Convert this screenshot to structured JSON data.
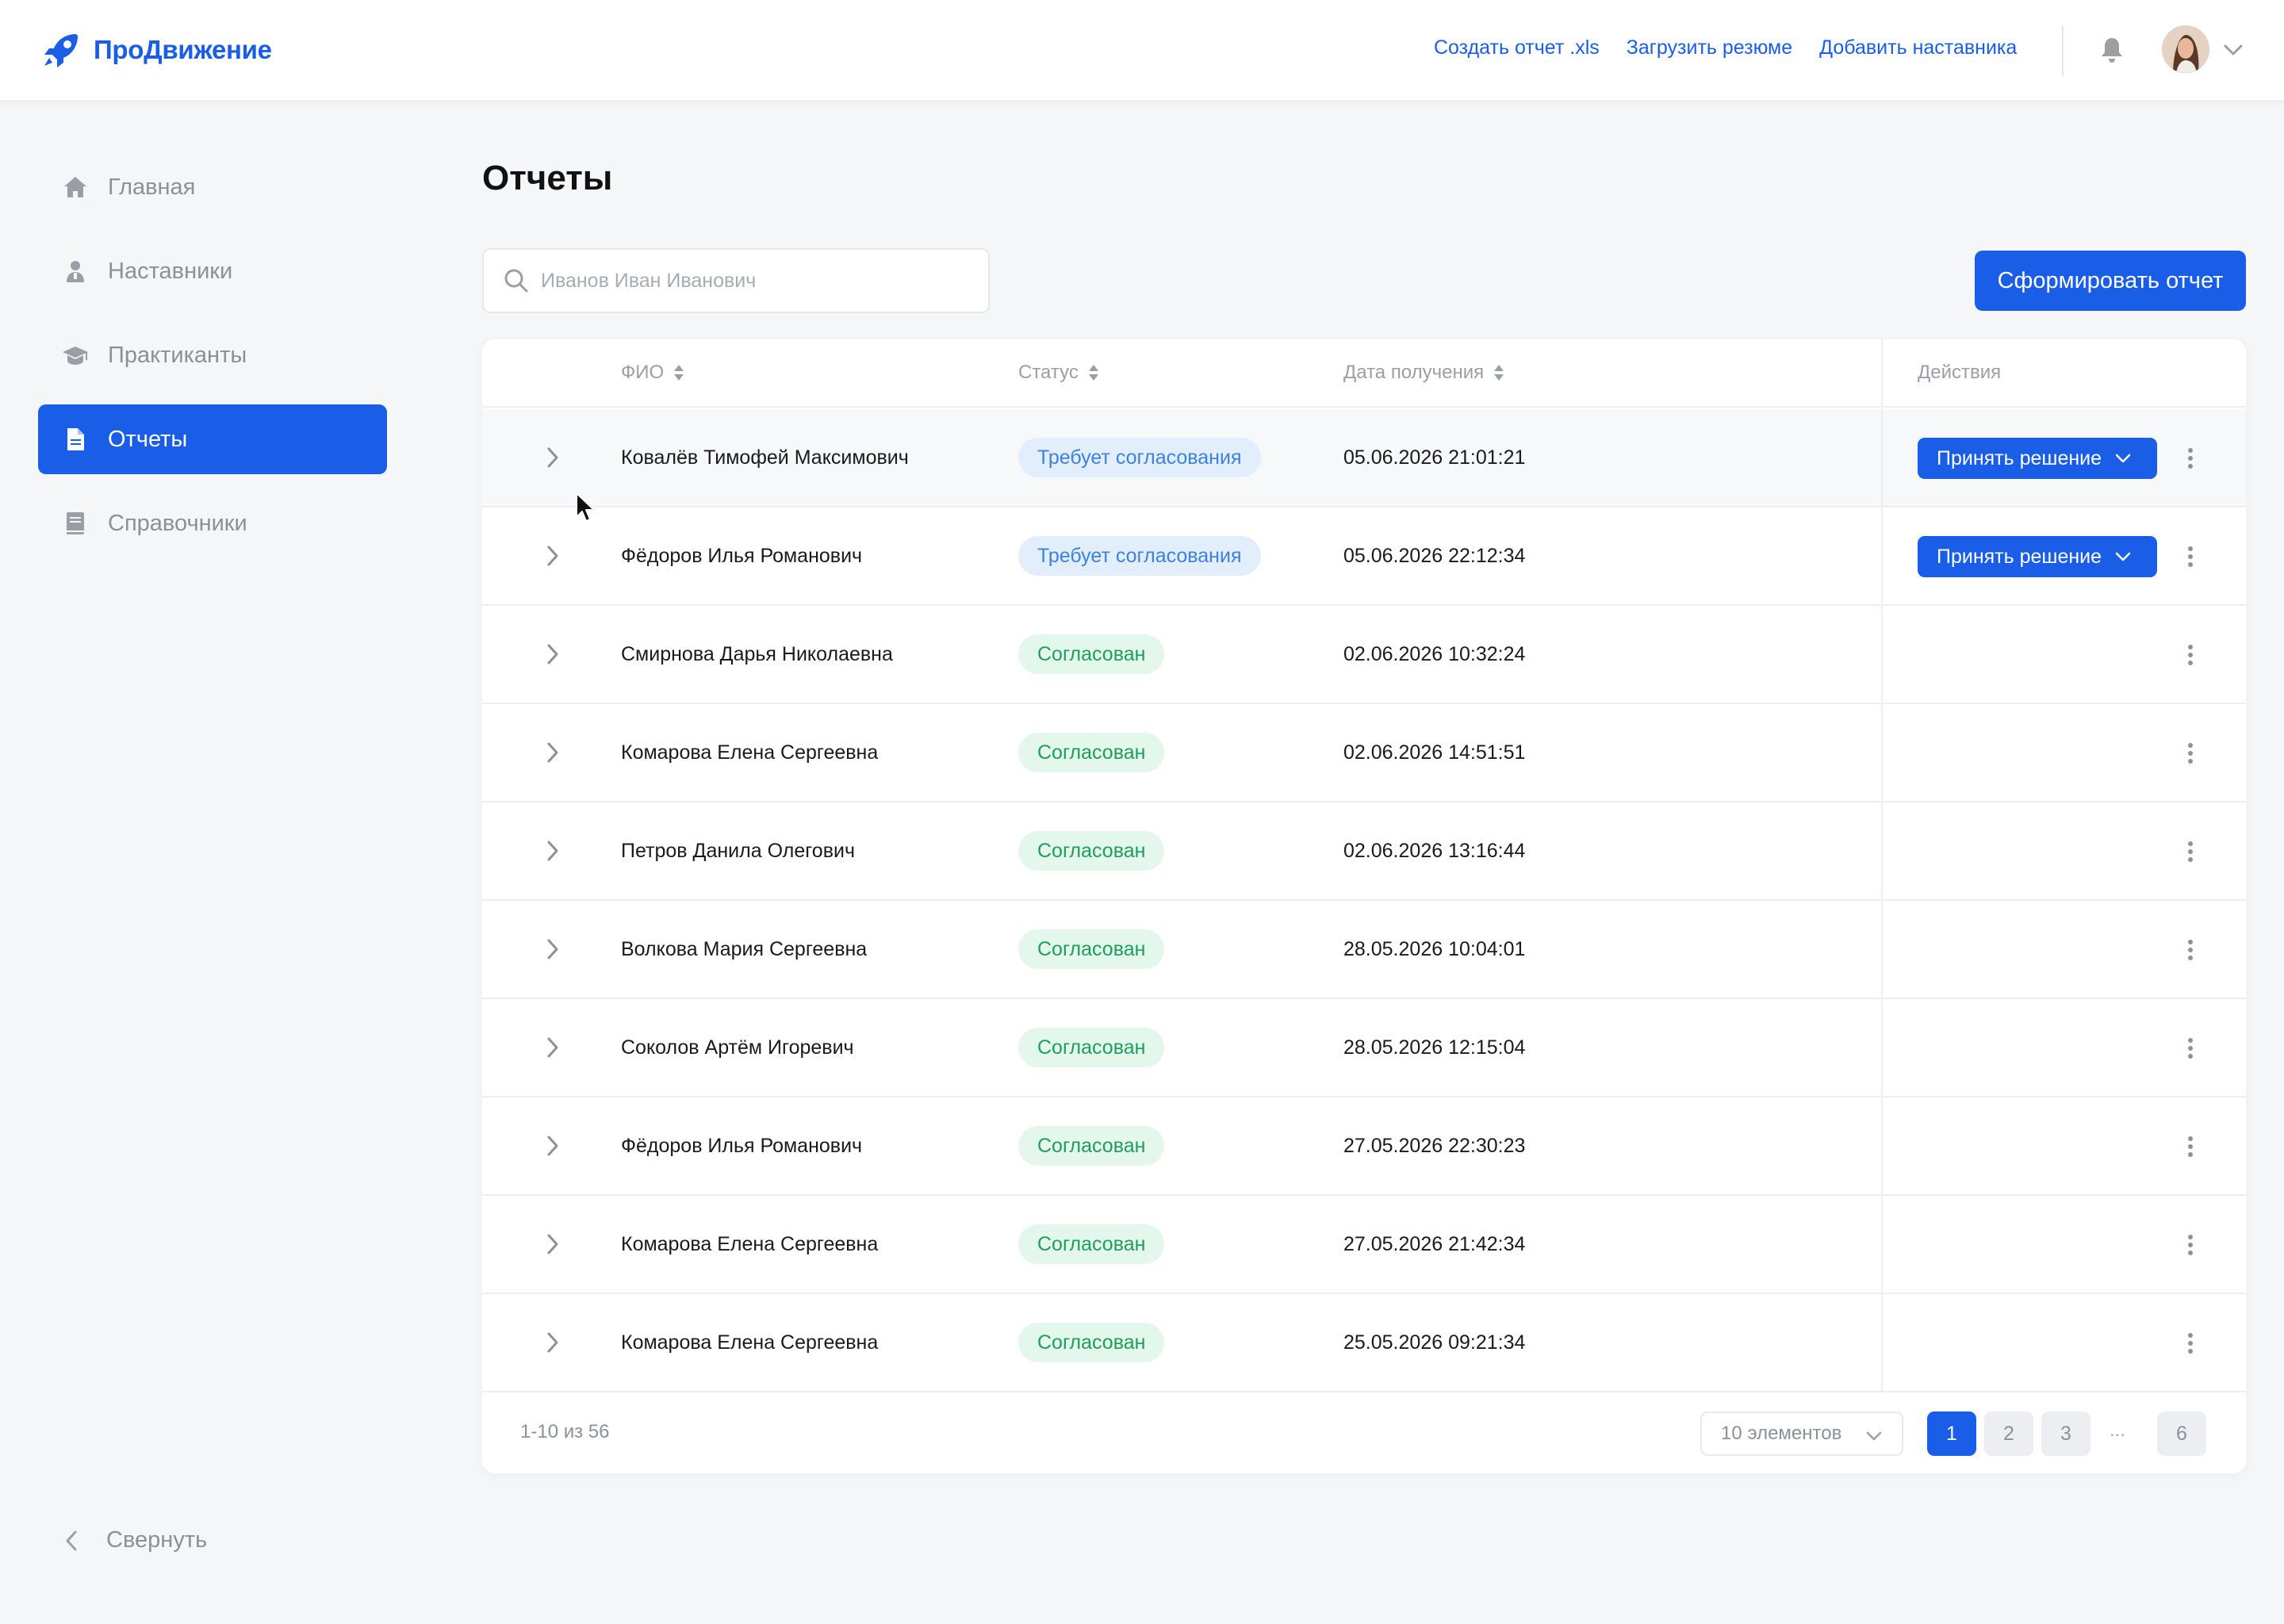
{
  "app": {
    "name": "ПроДвижение"
  },
  "header": {
    "links": [
      "Создать отчет .xls",
      "Загрузить резюме",
      "Добавить наставника"
    ]
  },
  "sidebar": {
    "items": [
      {
        "label": "Главная",
        "icon": "home-icon",
        "active": false
      },
      {
        "label": "Наставники",
        "icon": "mentor-icon",
        "active": false
      },
      {
        "label": "Практиканты",
        "icon": "graduation-cap-icon",
        "active": false
      },
      {
        "label": "Отчеты",
        "icon": "document-icon",
        "active": true
      },
      {
        "label": "Справочники",
        "icon": "book-icon",
        "active": false
      }
    ],
    "collapse_label": "Свернуть"
  },
  "main": {
    "title": "Отчеты",
    "search_placeholder": "Иванов Иван Иванович",
    "primary_button": "Сформировать отчет"
  },
  "table": {
    "columns": {
      "name": "ФИО",
      "status": "Статус",
      "date": "Дата получения",
      "actions": "Действия"
    },
    "decide_label": "Принять решение",
    "rows": [
      {
        "name": "Ковалёв Тимофей Максимович",
        "status": "Требует согласования",
        "status_type": "pending",
        "date": "05.06.2026 21:01:21"
      },
      {
        "name": "Фёдоров Илья Романович",
        "status": "Требует согласования",
        "status_type": "pending",
        "date": "05.06.2026 22:12:34"
      },
      {
        "name": "Смирнова Дарья Николаевна",
        "status": "Согласован",
        "status_type": "ok",
        "date": "02.06.2026 10:32:24"
      },
      {
        "name": "Комарова Елена Сергеевна",
        "status": "Согласован",
        "status_type": "ok",
        "date": "02.06.2026 14:51:51"
      },
      {
        "name": "Петров Данила Олегович",
        "status": "Согласован",
        "status_type": "ok",
        "date": "02.06.2026 13:16:44"
      },
      {
        "name": "Волкова Мария Сергеевна",
        "status": "Согласован",
        "status_type": "ok",
        "date": "28.05.2026 10:04:01"
      },
      {
        "name": "Соколов Артём Игоревич",
        "status": "Согласован",
        "status_type": "ok",
        "date": "28.05.2026 12:15:04"
      },
      {
        "name": "Фёдоров Илья Романович",
        "status": "Согласован",
        "status_type": "ok",
        "date": "27.05.2026 22:30:23"
      },
      {
        "name": "Комарова Елена Сергеевна",
        "status": "Согласован",
        "status_type": "ok",
        "date": "27.05.2026 21:42:34"
      },
      {
        "name": "Комарова Елена Сергеевна",
        "status": "Согласован",
        "status_type": "ok",
        "date": "25.05.2026 09:21:34"
      }
    ]
  },
  "pagination": {
    "range_text": "1-10 из 56",
    "page_size_label": "10 элементов",
    "pages": [
      "1",
      "2",
      "3",
      "6"
    ],
    "ellipsis": "...",
    "current_page": "1"
  },
  "colors": {
    "accent": "#1a5de6",
    "pending_bg": "#e3eefc",
    "pending_text": "#3b82e0",
    "ok_bg": "#e3f7ec",
    "ok_text": "#1e9e5a"
  }
}
